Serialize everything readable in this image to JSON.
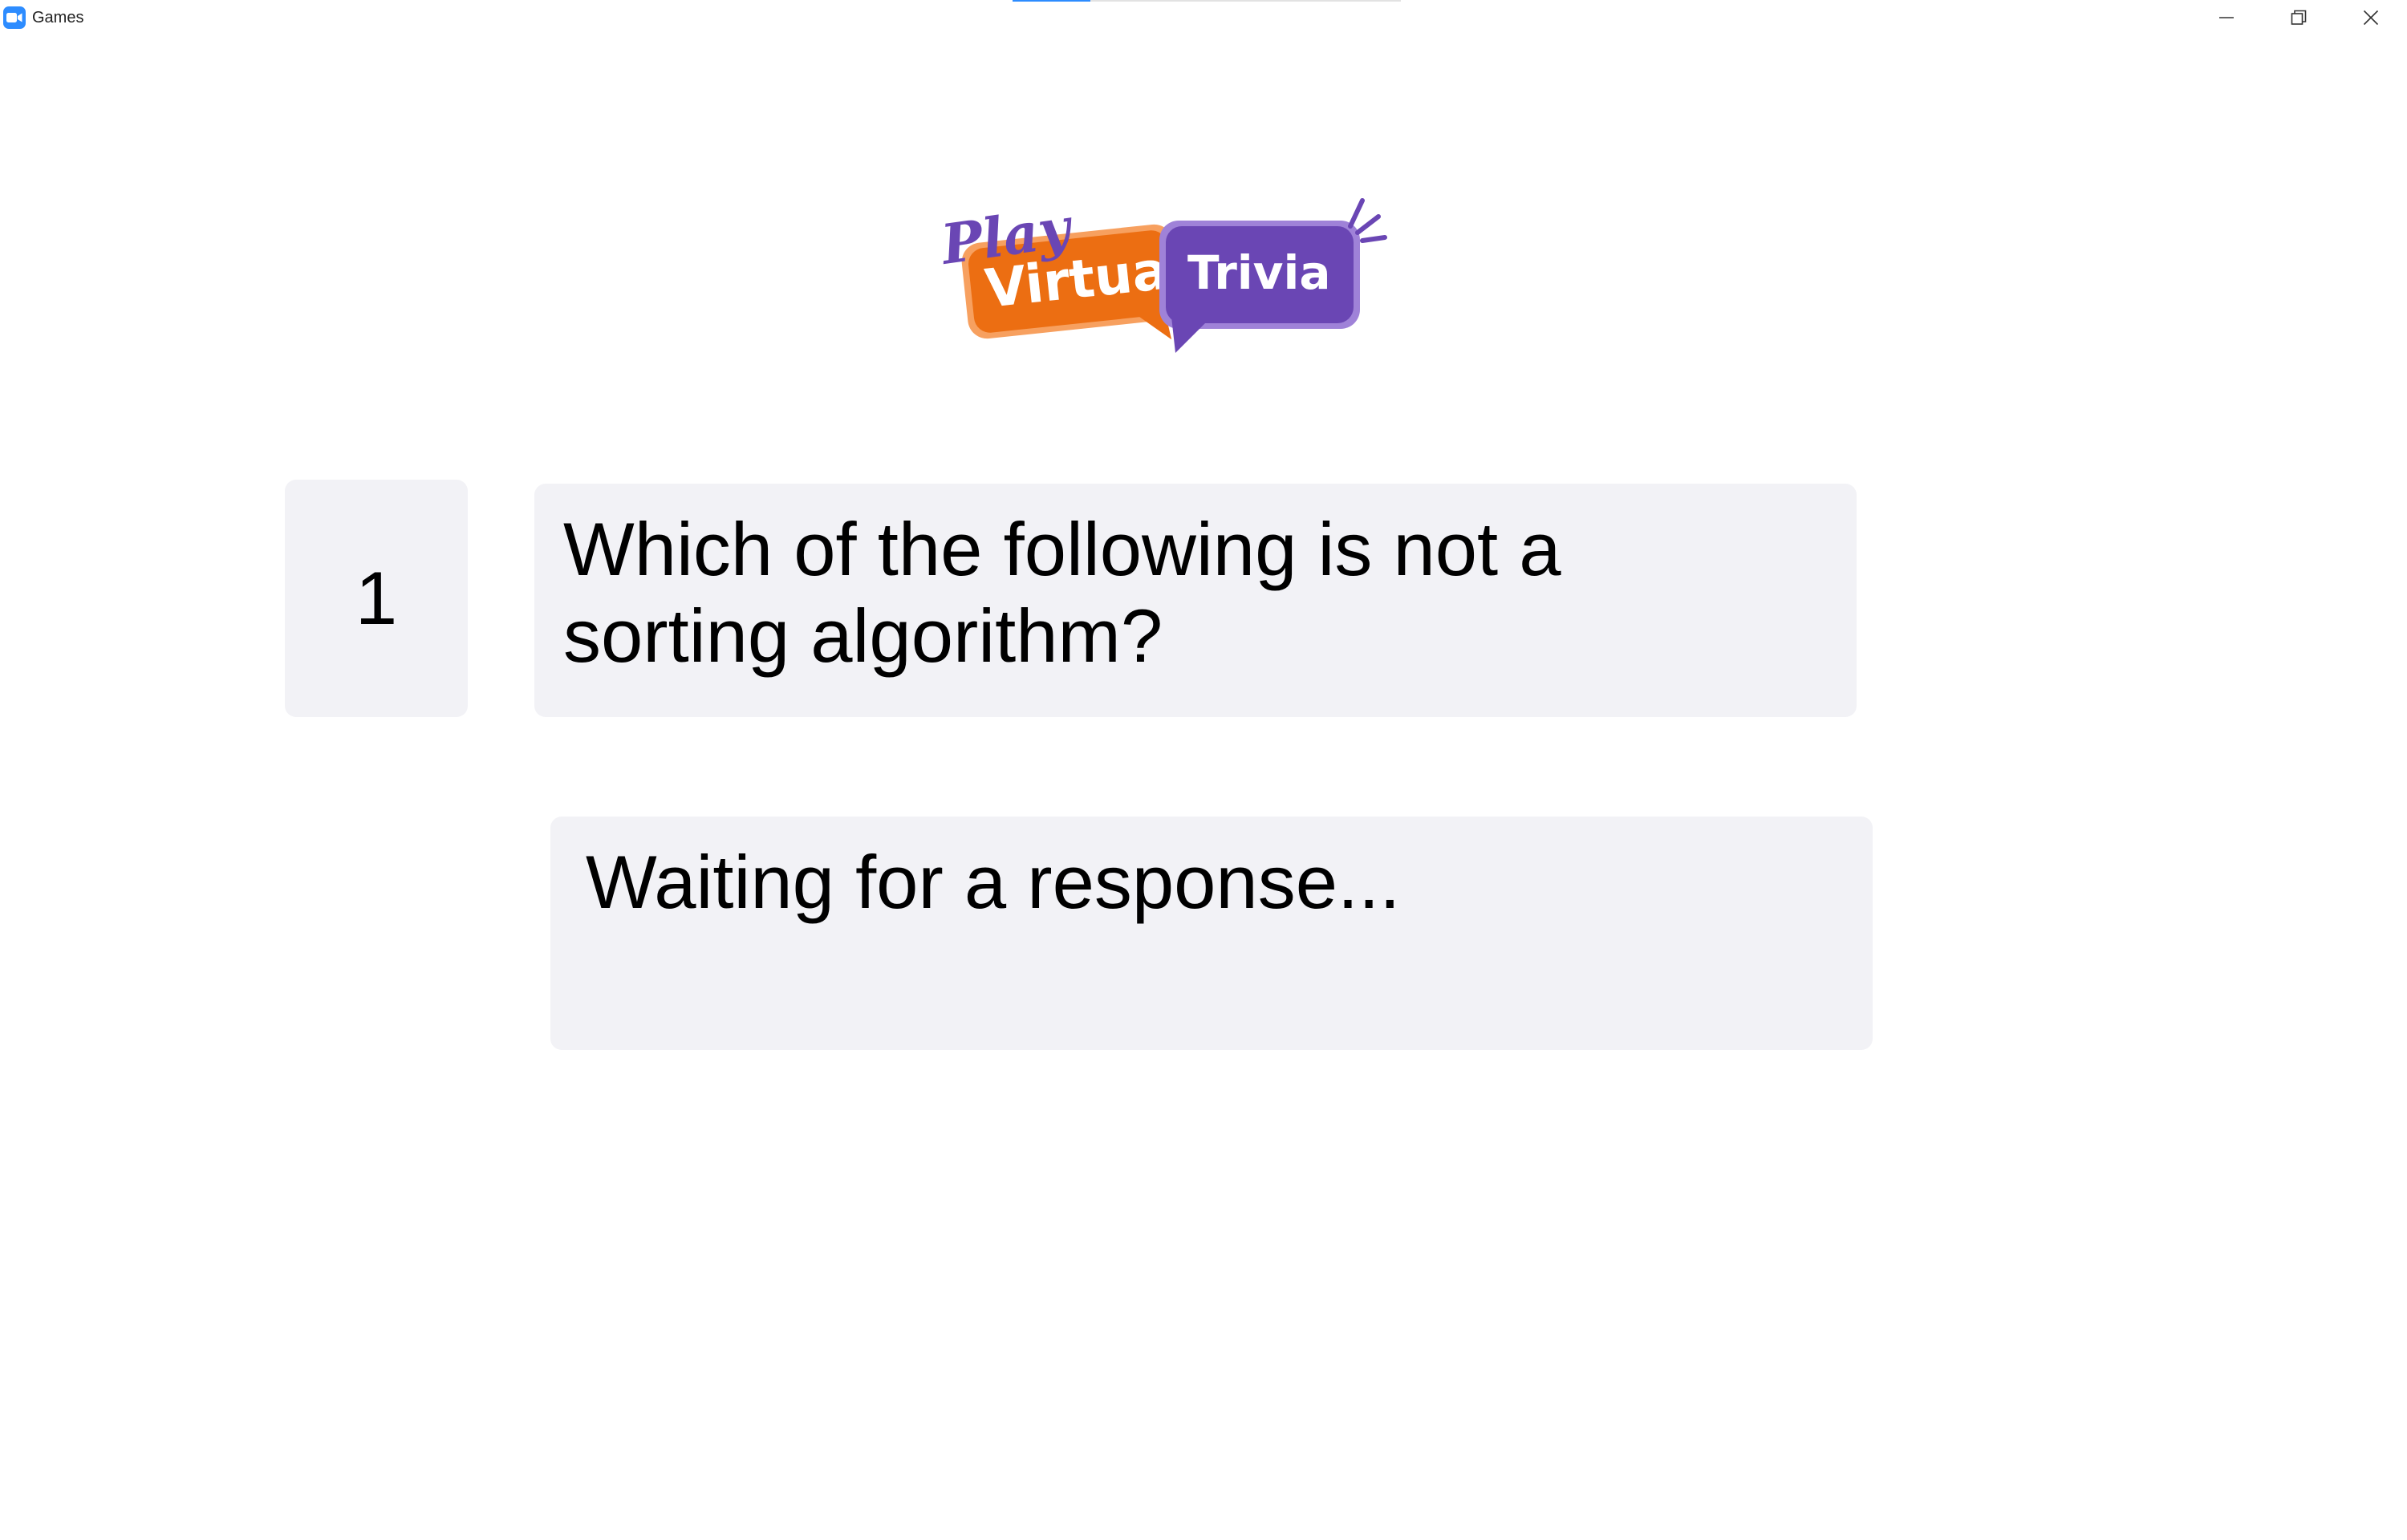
{
  "window": {
    "title": "Games",
    "loading_progress": 0.2
  },
  "logo": {
    "word_play": "Play",
    "word_virtual": "Virtual",
    "word_trivia": "Trivia",
    "colors": {
      "purple": "#6a46b4",
      "orange": "#ec6e12"
    }
  },
  "question": {
    "number": "1",
    "text": "Which of the following is not a sorting algorithm?"
  },
  "response": {
    "status": "Waiting for a response..."
  },
  "colors": {
    "card_background": "#f2f2f6",
    "accent": "#2d8cff"
  }
}
